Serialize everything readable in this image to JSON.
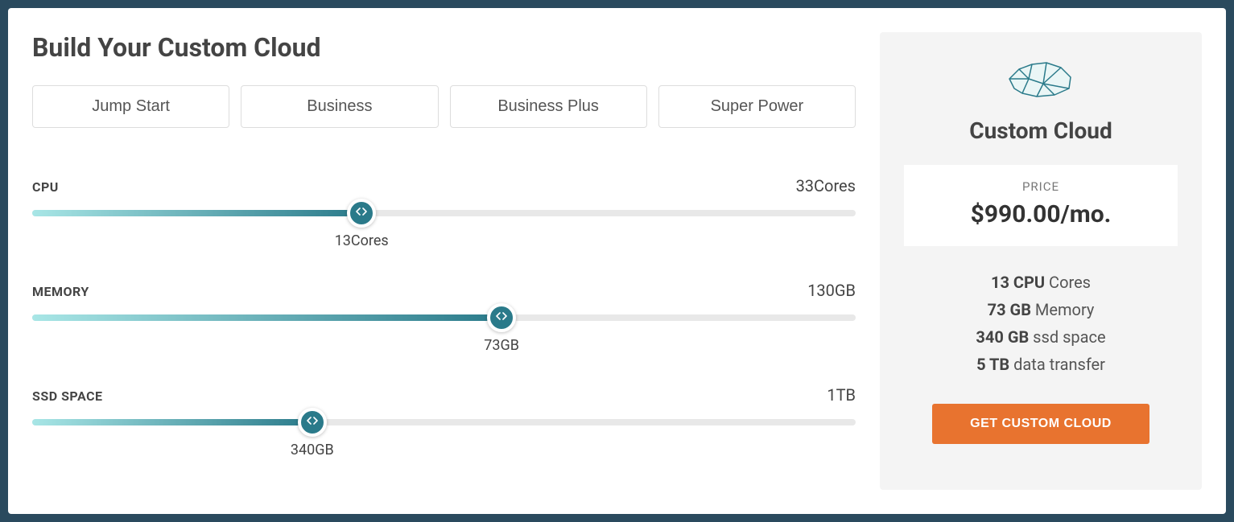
{
  "title": "Build Your Custom Cloud",
  "presets": [
    {
      "label": "Jump Start"
    },
    {
      "label": "Business"
    },
    {
      "label": "Business Plus"
    },
    {
      "label": "Super Power"
    }
  ],
  "sliders": {
    "cpu": {
      "label": "CPU",
      "max_label": "33Cores",
      "value_label": "13Cores",
      "percent": 40
    },
    "memory": {
      "label": "MEMORY",
      "max_label": "130GB",
      "value_label": "73GB",
      "percent": 57
    },
    "ssd": {
      "label": "SSD SPACE",
      "max_label": "1TB",
      "value_label": "340GB",
      "percent": 34
    }
  },
  "summary": {
    "title": "Custom Cloud",
    "price_label": "PRICE",
    "price_value": "$990.00/mo.",
    "specs": {
      "cpu_bold": "13 CPU",
      "cpu_rest": " Cores",
      "mem_bold": "73 GB",
      "mem_rest": " Memory",
      "ssd_bold": "340 GB",
      "ssd_rest": " ssd space",
      "transfer_bold": "5 TB",
      "transfer_rest": " data transfer"
    },
    "cta": "GET CUSTOM CLOUD"
  },
  "colors": {
    "accent": "#2a7a8a",
    "cta": "#e8732f"
  }
}
